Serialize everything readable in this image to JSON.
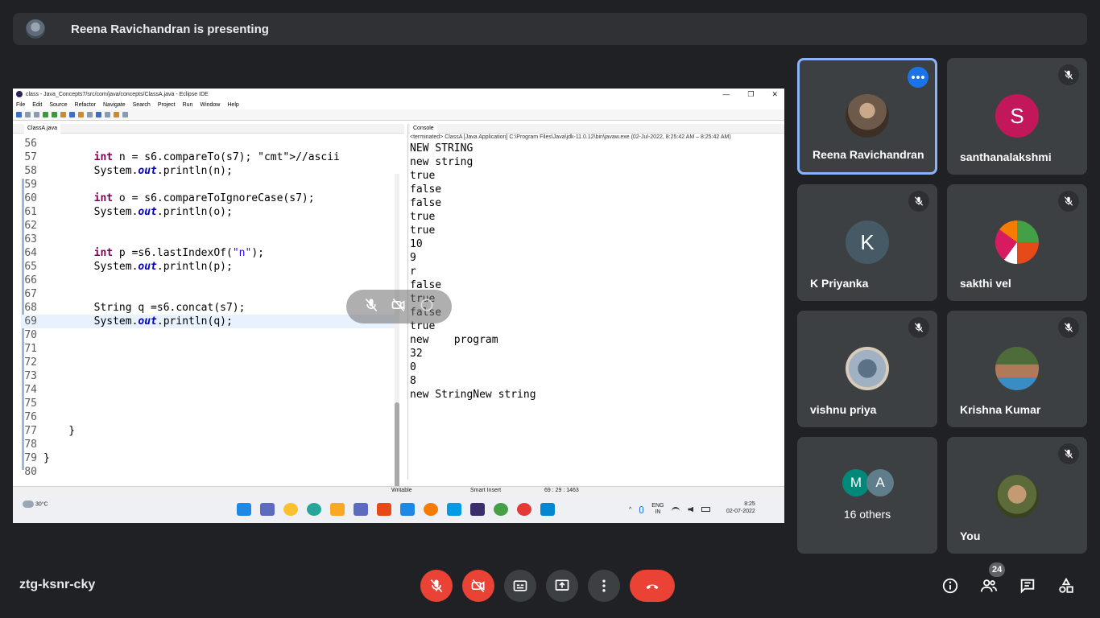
{
  "presenting": {
    "text": "Reena Ravichandran is presenting"
  },
  "eclipse": {
    "window_title": "class - Java_Concepts7/src/com/java/concepts/ClassA.java - Eclipse IDE",
    "window_controls": [
      "—",
      "❐",
      "✕"
    ],
    "menu": [
      "File",
      "Edit",
      "Source",
      "Refactor",
      "Navigate",
      "Search",
      "Project",
      "Run",
      "Window",
      "Help"
    ],
    "editor_tab": "ClassA.java",
    "code_lines": [
      {
        "n": "56",
        "code": ""
      },
      {
        "n": "57",
        "code": "        int n = s6.compareTo(s7); //ascii"
      },
      {
        "n": "58",
        "code": "        System.out.println(n);"
      },
      {
        "n": "59",
        "code": ""
      },
      {
        "n": "60",
        "code": "        int o = s6.compareToIgnoreCase(s7);"
      },
      {
        "n": "61",
        "code": "        System.out.println(o);"
      },
      {
        "n": "62",
        "code": ""
      },
      {
        "n": "63",
        "code": ""
      },
      {
        "n": "64",
        "code": "        int p =s6.lastIndexOf(\"n\");"
      },
      {
        "n": "65",
        "code": "        System.out.println(p);"
      },
      {
        "n": "66",
        "code": ""
      },
      {
        "n": "67",
        "code": ""
      },
      {
        "n": "68",
        "code": "        String q =s6.concat(s7);"
      },
      {
        "n": "69",
        "code": "        System.out.println(q);"
      },
      {
        "n": "70",
        "code": ""
      },
      {
        "n": "71",
        "code": ""
      },
      {
        "n": "72",
        "code": ""
      },
      {
        "n": "73",
        "code": ""
      },
      {
        "n": "74",
        "code": ""
      },
      {
        "n": "75",
        "code": ""
      },
      {
        "n": "76",
        "code": ""
      },
      {
        "n": "77",
        "code": "    }"
      },
      {
        "n": "78",
        "code": ""
      },
      {
        "n": "79",
        "code": "}"
      },
      {
        "n": "80",
        "code": ""
      }
    ],
    "current_line": "69",
    "console_tab": "Console",
    "console_info": "<terminated> ClassA [Java Application] C:\\Program Files\\Java\\jdk-11.0.12\\bin\\javaw.exe  (02-Jul-2022, 8:25:42 AM – 8:25:42 AM)",
    "console_output": [
      "NEW STRING",
      "new string",
      "true",
      "false",
      "false",
      "true",
      "true",
      "10",
      "9",
      "r",
      "false",
      "true",
      "false",
      "true",
      "new    program",
      "32",
      "0",
      "8",
      "new StringNew string"
    ],
    "status": {
      "writable": "Writable",
      "insert": "Smart Insert",
      "position": "69 : 29 : 1463"
    }
  },
  "taskbar": {
    "weather": "30°C",
    "lang1": "ENG",
    "lang2": "IN",
    "time": "8:25",
    "date": "02-07-2022"
  },
  "participants": [
    {
      "name": "Reena Ravichandran",
      "avatar_type": "photo",
      "color": "#6d5a4a",
      "active": true
    },
    {
      "name": "santhanalakshmi",
      "avatar_letter": "S",
      "color": "#c2185b",
      "muted": true
    },
    {
      "name": "K Priyanka",
      "avatar_letter": "K",
      "color": "#455a64",
      "muted": true
    },
    {
      "name": "sakthi vel",
      "avatar_type": "photo",
      "color": "#d84315",
      "muted": true
    },
    {
      "name": "vishnu priya",
      "avatar_type": "photo",
      "color": "#7e8fa3",
      "muted": true
    },
    {
      "name": "Krishna Kumar",
      "avatar_type": "photo",
      "color": "#4e6b3a",
      "muted": true
    },
    {
      "name": "You",
      "avatar_type": "photo",
      "color": "#5d6a3a",
      "muted": true
    }
  ],
  "others": {
    "letters": [
      "M",
      "A"
    ],
    "colors": [
      "#00897b",
      "#607d8b"
    ],
    "label": "16 others"
  },
  "meeting_code": "ztg-ksnr-cky",
  "people_count": "24",
  "colors": {
    "background": "#202124",
    "tile": "#3c4043",
    "danger": "#ea4335",
    "active_border": "#8ab4f8",
    "more_button": "#1a73e8"
  }
}
